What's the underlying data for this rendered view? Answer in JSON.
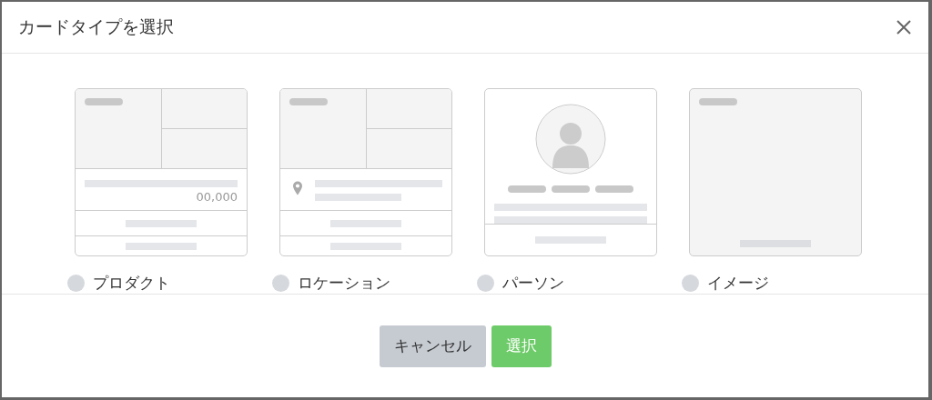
{
  "dialog": {
    "title": "カードタイプを選択"
  },
  "card_types": [
    {
      "kind": "product",
      "label": "プロダクト",
      "price": "00,000",
      "selected": false
    },
    {
      "kind": "location",
      "label": "ロケーション",
      "selected": false
    },
    {
      "kind": "person",
      "label": "パーソン",
      "selected": false
    },
    {
      "kind": "image",
      "label": "イメージ",
      "selected": false
    }
  ],
  "buttons": [
    {
      "kind": "cancel",
      "label": "キャンセル"
    },
    {
      "kind": "primary",
      "label": "選択"
    }
  ]
}
